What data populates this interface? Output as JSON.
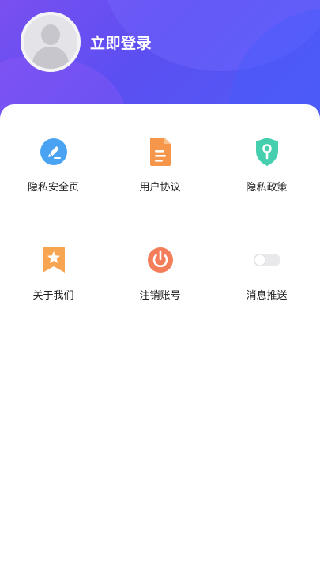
{
  "header": {
    "login_label": "立即登录"
  },
  "menu": {
    "items": [
      {
        "label": "隐私安全页",
        "icon": "pencil-circle-icon",
        "color": "#4aa3f2"
      },
      {
        "label": "用户协议",
        "icon": "document-icon",
        "color": "#f5964a"
      },
      {
        "label": "隐私政策",
        "icon": "shield-key-icon",
        "color": "#45cfae"
      },
      {
        "label": "关于我们",
        "icon": "star-bookmark-icon",
        "color": "#f8a552"
      },
      {
        "label": "注销账号",
        "icon": "power-icon",
        "color": "#f47e5a"
      },
      {
        "label": "消息推送",
        "icon": "toggle-switch-icon",
        "color": "#e4e4e6"
      }
    ]
  },
  "colors": {
    "header_gradient_start": "#7a4ff0",
    "header_gradient_end": "#4f5df6",
    "text": "#222222"
  }
}
